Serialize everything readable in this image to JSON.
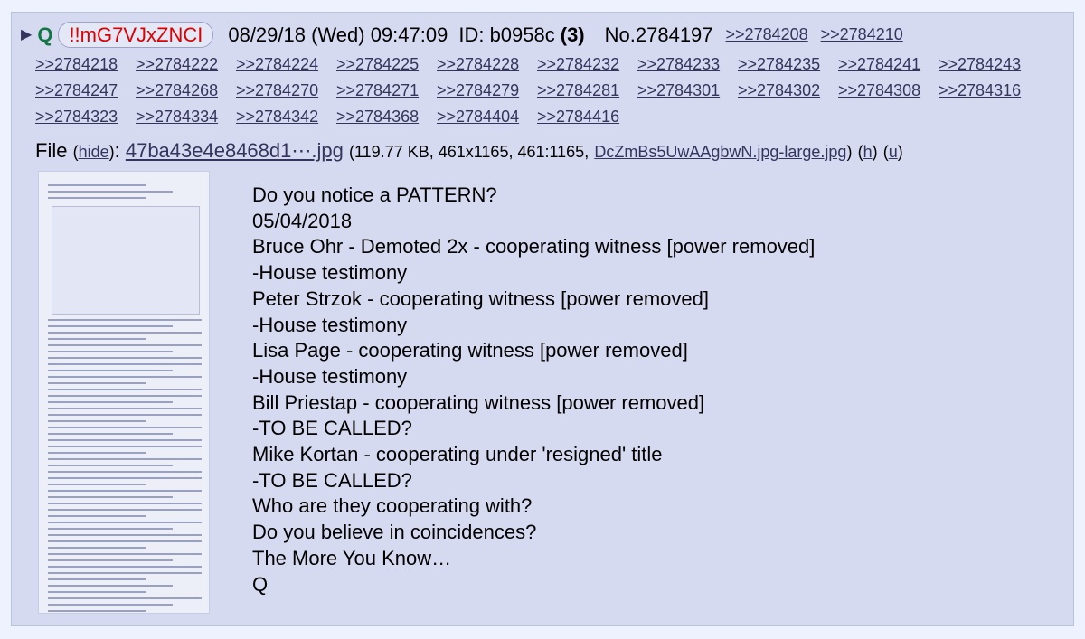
{
  "post": {
    "arrow": "▶",
    "name": "Q",
    "tripcode": "!!mG7VJxZNCI",
    "datetime": "08/29/18 (Wed) 09:47:09",
    "id_label": "ID: b0958c",
    "id_count": "(3)",
    "post_number": "No.2784197",
    "replies": [
      ">>2784208",
      ">>2784210",
      ">>2784218",
      ">>2784222",
      ">>2784224",
      ">>2784225",
      ">>2784228",
      ">>2784232",
      ">>2784233",
      ">>2784235",
      ">>2784241",
      ">>2784243",
      ">>2784247",
      ">>2784268",
      ">>2784270",
      ">>2784271",
      ">>2784279",
      ">>2784281",
      ">>2784301",
      ">>2784302",
      ">>2784308",
      ">>2784316",
      ">>2784323",
      ">>2784334",
      ">>2784342",
      ">>2784368",
      ">>2784404",
      ">>2784416"
    ],
    "file": {
      "label": "File",
      "hide": "hide",
      "filename": "47ba43e4e8468d1⋯.jpg",
      "meta": "(119.77 KB, 461x1165, 461:1165,",
      "original_name": "DcZmBs5UwAAgbwN.jpg-large.jpg",
      "h": "h",
      "u": "u"
    },
    "message": [
      "Do you notice a PATTERN?",
      "05/04/2018",
      "Bruce Ohr - Demoted 2x - cooperating witness [power removed]",
      "-House testimony",
      "Peter Strzok - cooperating witness [power removed]",
      "-House testimony",
      "Lisa Page - cooperating witness [power removed]",
      "-House testimony",
      "Bill Priestap - cooperating witness [power removed]",
      "-TO BE CALLED?",
      "Mike Kortan - cooperating under 'resigned' title",
      "-TO BE CALLED?",
      "Who are they cooperating with?",
      "Do you believe in coincidences?",
      "The More You Know…",
      "Q"
    ]
  },
  "colors": {
    "page_bg": "#eef2ff",
    "post_bg": "#d6daf0",
    "name": "#117743",
    "tripcode": "#dd0000",
    "link": "#34345c"
  }
}
